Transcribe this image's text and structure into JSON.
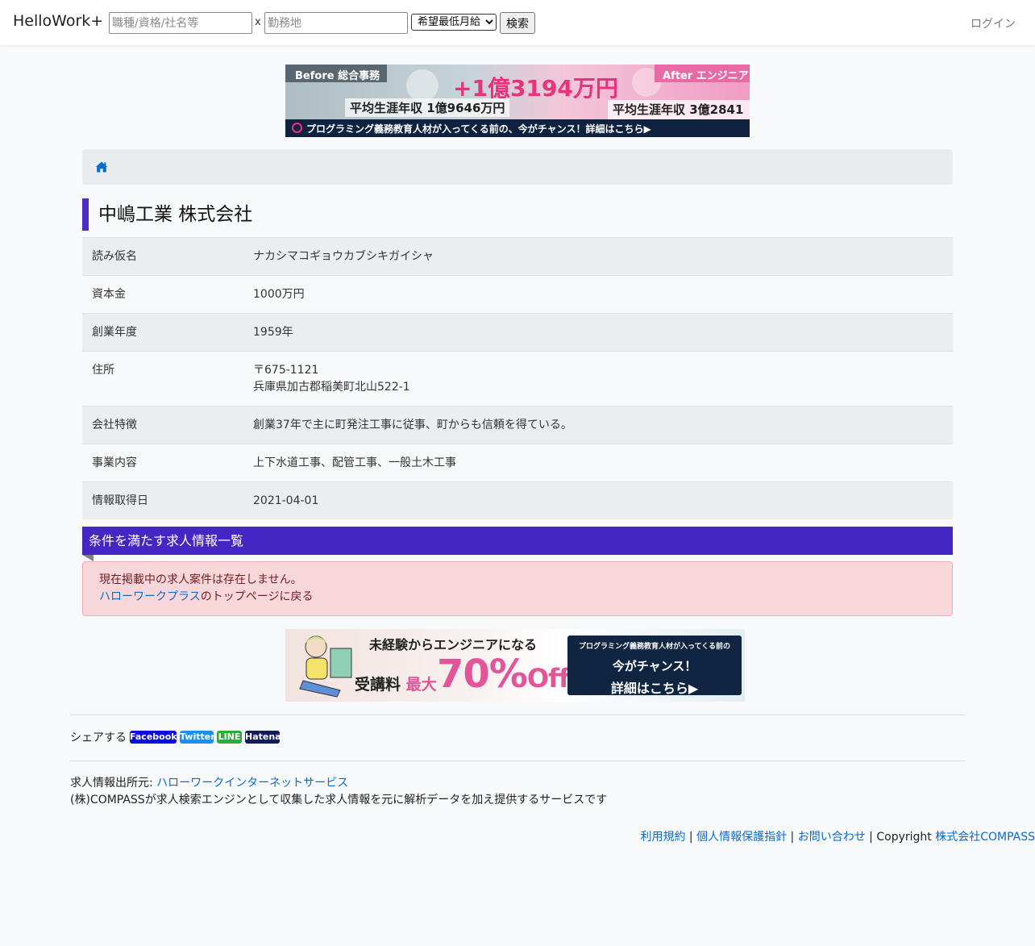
{
  "navbar": {
    "brand": "HelloWork+",
    "keyword_placeholder": "職種/資格/社名等",
    "separator": "x",
    "location_placeholder": "勤務地",
    "salary_select": "希望最低月給",
    "search_button": "検索",
    "login": "ログイン"
  },
  "banner_top": {
    "before_label": "Before 総合事務",
    "after_label": "After エンジニア",
    "headline": "+1億3194万円",
    "left_income": "平均生涯年収 1億9646万円",
    "right_income": "平均生涯年収 3億2841万円",
    "bottom_text": "プログラミング義務教育人材が入ってくる前の、今がチャンス！詳細はこちら▶"
  },
  "breadcrumb": {
    "icon": "home-icon"
  },
  "company": {
    "name": "中嶋工業 株式会社",
    "rows": [
      {
        "label": "読み仮名",
        "value": "ナカシマコギョウカブシキガイシャ"
      },
      {
        "label": "資本金",
        "value": "1000万円"
      },
      {
        "label": "創業年度",
        "value": "1959年"
      },
      {
        "label": "住所",
        "value": "〒675-1121",
        "value2": "兵庫県加古郡稲美町北山522-1"
      },
      {
        "label": "会社特徴",
        "value": "創業37年で主に町発注工事に従事、町からも信頼を得ている。"
      },
      {
        "label": "事業内容",
        "value": "上下水道工事、配管工事、一般土木工事"
      },
      {
        "label": "情報取得日",
        "value": "2021-04-01"
      }
    ]
  },
  "jobs": {
    "heading": "条件を満たす求人情報一覧",
    "empty_message": "現在掲載中の求人案件は存在しません。",
    "back_link": "ハローワークプラス",
    "back_suffix": "のトップページに戻る"
  },
  "banner_bottom": {
    "title": "未経験からエンジニアになる",
    "fee_label": "受講料",
    "fee_max": "最大",
    "discount": "70%",
    "off": "Off",
    "box_line1": "プログラミング義務教育人材が入ってくる前の",
    "box_line2": "今がチャンス！",
    "box_line3": "詳細はこちら▶"
  },
  "share": {
    "label": "シェアする",
    "buttons": [
      "Facebook",
      "Twitter",
      "LINE",
      "Hatena"
    ],
    "colors": [
      "#0a0ae6",
      "#1d8ff0",
      "#2eaa3e",
      "#111a5a"
    ]
  },
  "source": {
    "prefix": "求人情報出所元: ",
    "link": "ハローワークインターネットサービス",
    "description": "(株)COMPASSが求人検索エンジンとして収集した求人情報を元に解析データを加え提供するサービスです"
  },
  "footer": {
    "terms": "利用規約",
    "privacy": "個人情報保護指針",
    "contact": "お問い合わせ",
    "sep": " | ",
    "copyright": "Copyright ",
    "company": "株式会社COMPASS"
  },
  "colors": {
    "accent": "#4326c4",
    "title_bar": "#4f2bc7",
    "link": "#0b6bcb",
    "alert_bg": "#f8d7da"
  }
}
